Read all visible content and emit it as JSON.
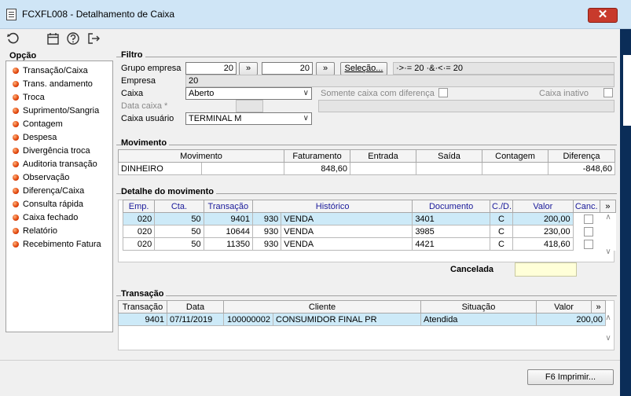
{
  "window": {
    "title": "FCXFL008 - Detalhamento de Caixa",
    "close_glyph": "✕"
  },
  "toolbar": {
    "icons": [
      "refresh-icon",
      "calendar-icon",
      "help-icon",
      "exit-icon"
    ]
  },
  "sidebar": {
    "title": "Opção",
    "items": [
      {
        "label": "Transação/Caixa"
      },
      {
        "label": "Trans. andamento"
      },
      {
        "label": "Troca"
      },
      {
        "label": "Suprimento/Sangria"
      },
      {
        "label": "Contagem"
      },
      {
        "label": "Despesa"
      },
      {
        "label": "Divergência troca"
      },
      {
        "label": "Auditoria transação"
      },
      {
        "label": "Observação"
      },
      {
        "label": "Diferença/Caixa"
      },
      {
        "label": "Consulta rápida"
      },
      {
        "label": "Caixa fechado"
      },
      {
        "label": "Relatório"
      },
      {
        "label": "Recebimento Fatura"
      }
    ]
  },
  "filtro": {
    "title": "Filtro",
    "grupo_empresa_label": "Grupo empresa",
    "grupo_from": "20",
    "grupo_to": "20",
    "arrow": "»",
    "selecao_label": "Seleção...",
    "selecao_expr": "·>·= 20 ·&·<·= 20",
    "empresa_label": "Empresa",
    "empresa_value": "20",
    "caixa_label": "Caixa",
    "caixa_value": "Aberto",
    "somente_label": "Somente caixa com diferença",
    "inativo_label": "Caixa inativo",
    "data_caixa_label": "Data caixa *",
    "caixa_usuario_label": "Caixa usuário",
    "caixa_usuario_value": "TERMINAL M"
  },
  "movimento": {
    "title": "Movimento",
    "headers": [
      "Movimento",
      "",
      "Faturamento",
      "Entrada",
      "Saída",
      "Contagem",
      "Diferença"
    ],
    "row": [
      "DINHEIRO",
      "",
      "848,60",
      "",
      "",
      "",
      "-848,60"
    ]
  },
  "detalhe": {
    "title": "Detalhe do movimento",
    "headers": [
      "Emp.",
      "Cta.",
      "Transação",
      "Histórico",
      "",
      "Documento",
      "C./D.",
      "Valor",
      "Canc.",
      "»"
    ],
    "rows": [
      [
        "020",
        "50",
        "9401",
        "930",
        "VENDA",
        "3401",
        "C",
        "200,00"
      ],
      [
        "020",
        "50",
        "10644",
        "930",
        "VENDA",
        "3985",
        "C",
        "230,00"
      ],
      [
        "020",
        "50",
        "11350",
        "930",
        "VENDA",
        "4421",
        "C",
        "418,60"
      ]
    ],
    "cancelada_label": "Cancelada"
  },
  "transacao": {
    "title": "Transação",
    "headers": [
      "Transação",
      "Data",
      "Cliente",
      "",
      "Situação",
      "Valor",
      "»"
    ],
    "rows": [
      [
        "9401",
        "07/11/2019",
        "100000002",
        "CONSUMIDOR FINAL PR",
        "Atendida",
        "200,00"
      ]
    ]
  },
  "footer": {
    "print_label": "F6 Imprimir..."
  }
}
